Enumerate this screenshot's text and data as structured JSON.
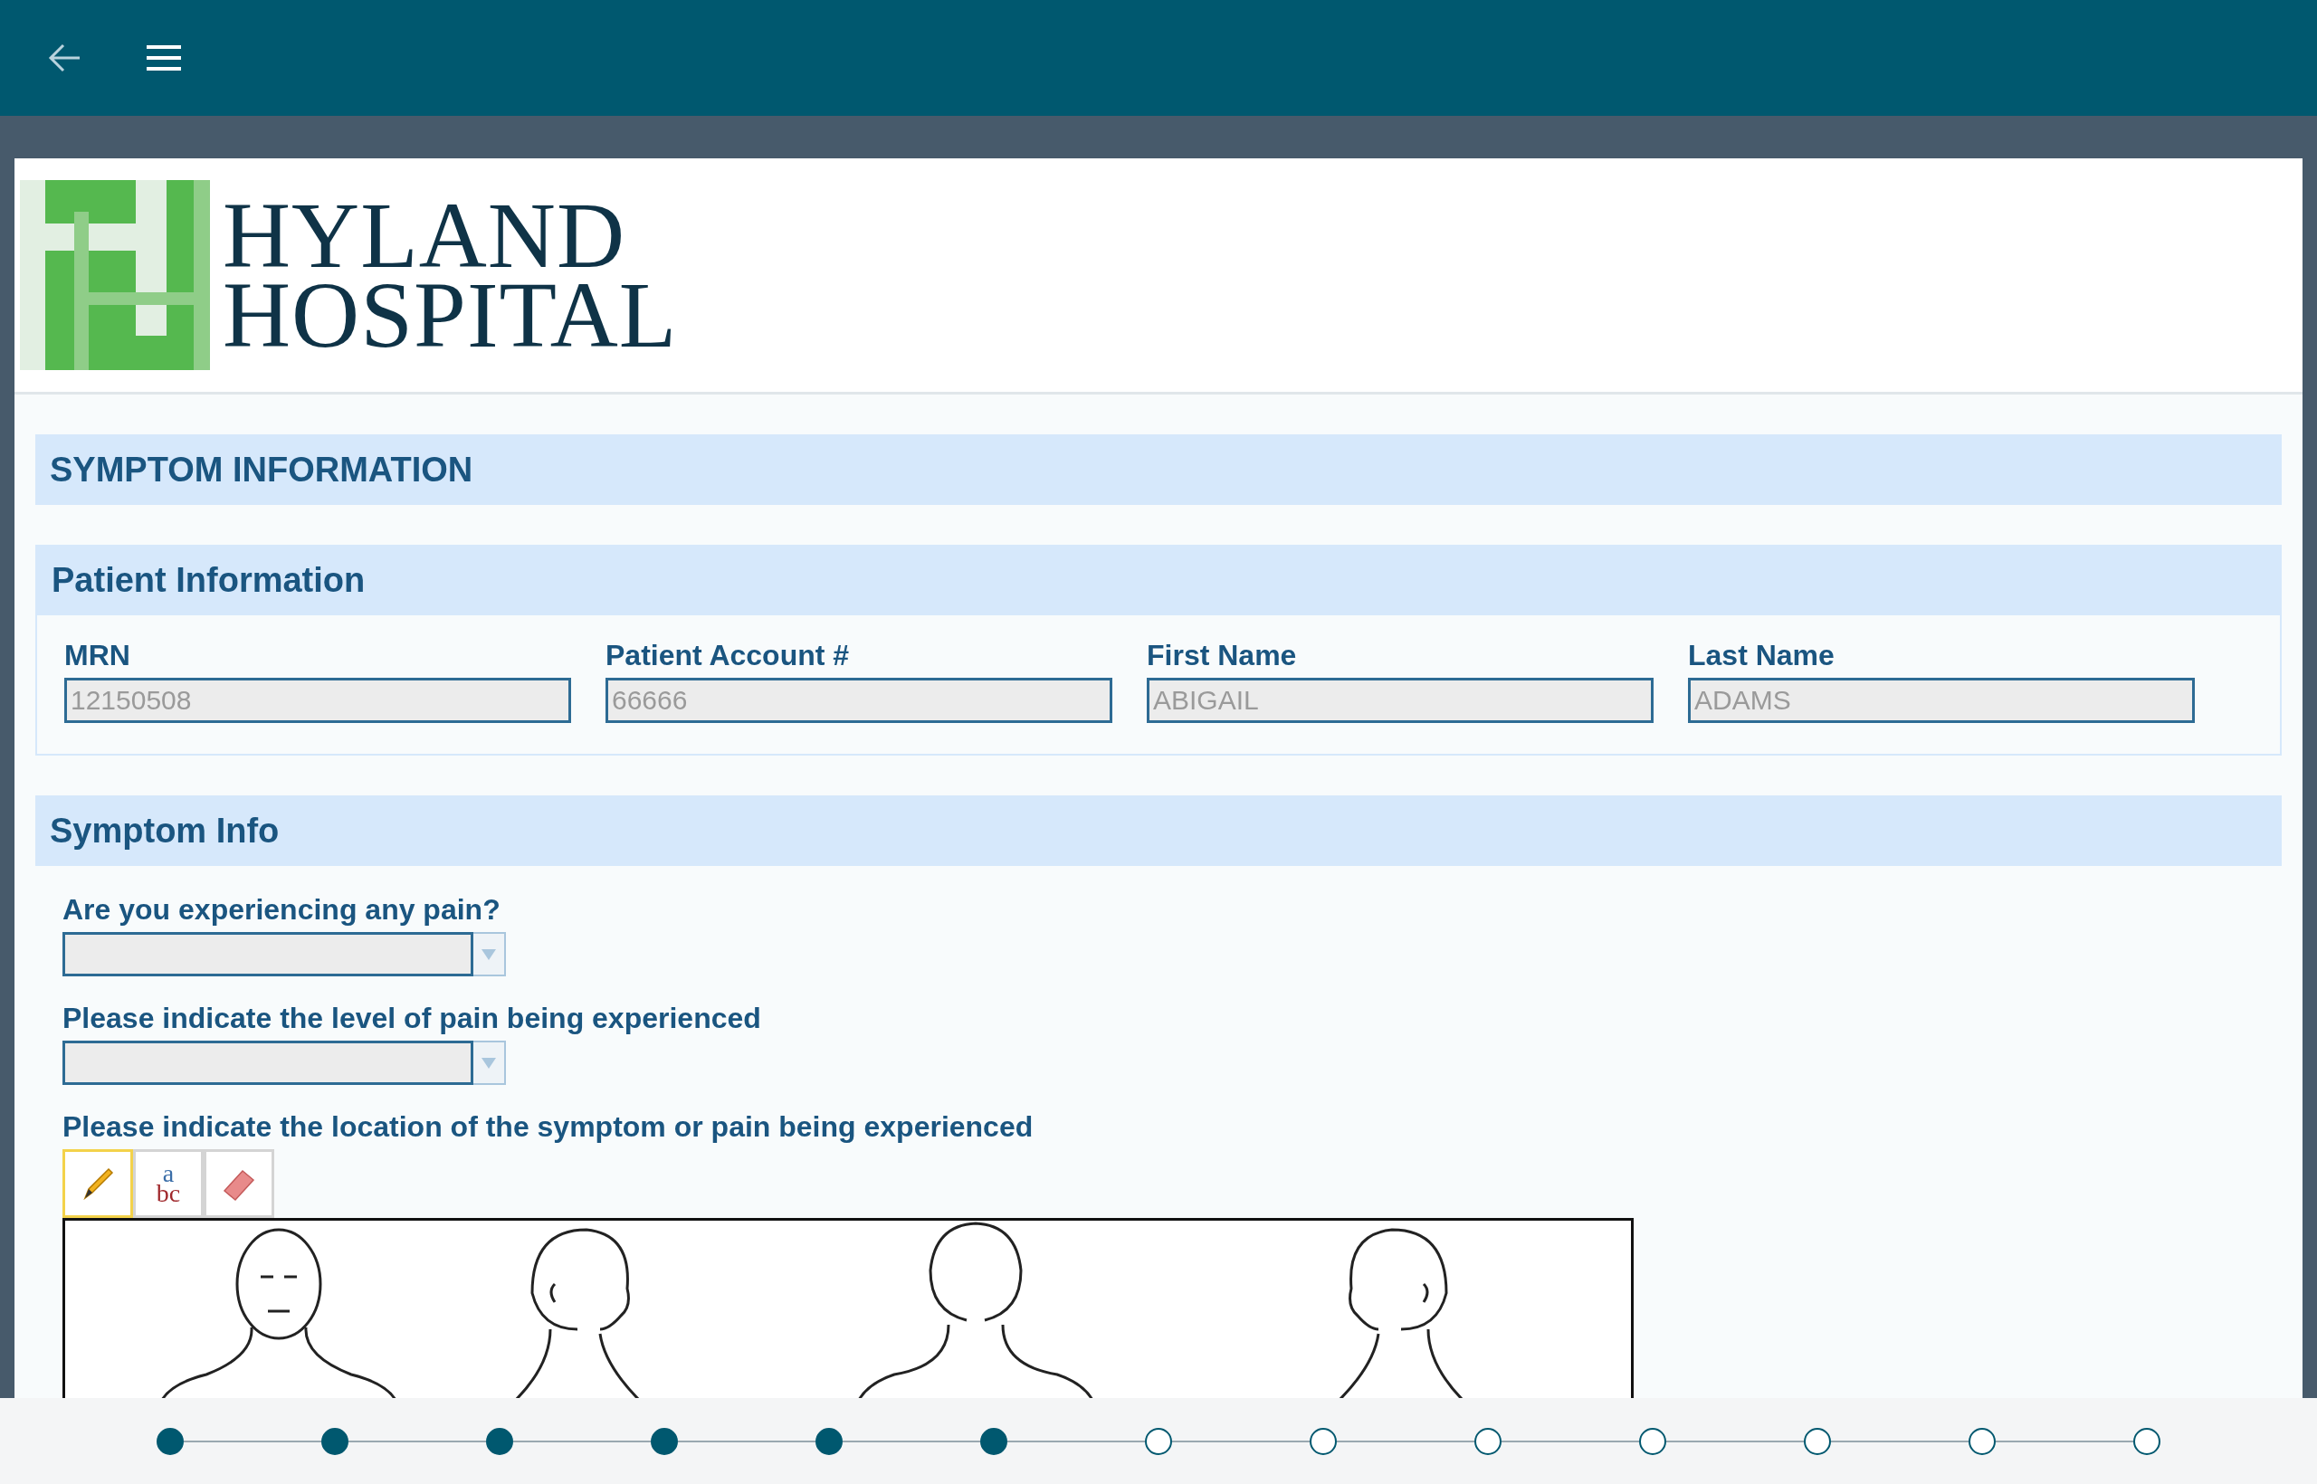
{
  "logo": {
    "line1": "HYLAND",
    "line2": "HOSPITAL"
  },
  "form_title": "SYMPTOM INFORMATION",
  "patient_section": {
    "title": "Patient Information",
    "fields": [
      {
        "label": "MRN",
        "value": "12150508"
      },
      {
        "label": "Patient Account #",
        "value": "66666"
      },
      {
        "label": "First Name",
        "value": "ABIGAIL"
      },
      {
        "label": "Last Name",
        "value": "ADAMS"
      }
    ]
  },
  "symptom_section": {
    "title": "Symptom Info",
    "questions": [
      {
        "kind": "dropdown",
        "label": "Are you experiencing any pain?"
      },
      {
        "kind": "dropdown",
        "label": "Please indicate the level of pain being experienced"
      },
      {
        "kind": "drawing",
        "label": "Please indicate the location of the symptom or pain being experienced",
        "tools": [
          {
            "kind": "pencil",
            "selected": true
          },
          {
            "kind": "text",
            "selected": false,
            "glyph_top": "a",
            "glyph_bottom": "bc"
          },
          {
            "kind": "eraser",
            "selected": false
          }
        ]
      }
    ]
  },
  "steps": [
    {
      "done": true
    },
    {
      "done": true
    },
    {
      "done": true
    },
    {
      "done": true
    },
    {
      "done": true
    },
    {
      "done": true
    },
    {
      "done": false
    },
    {
      "done": false
    },
    {
      "done": false
    },
    {
      "done": false
    },
    {
      "done": false
    },
    {
      "done": false
    },
    {
      "done": false
    }
  ]
}
